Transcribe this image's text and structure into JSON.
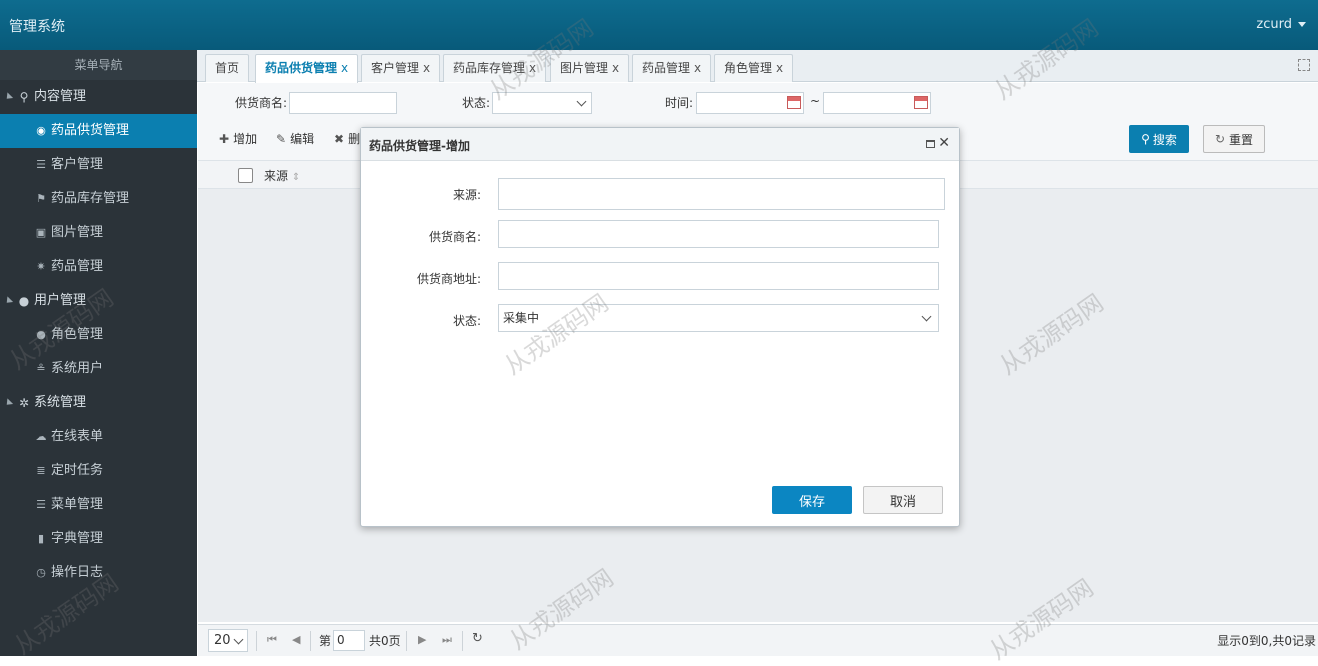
{
  "app": {
    "title": "管理系统",
    "user": "zcurd"
  },
  "sidebar": {
    "header": "菜单导航",
    "groups": [
      {
        "label": "内容管理",
        "items": [
          "药品供货管理",
          "客户管理",
          "药品库存管理",
          "图片管理",
          "药品管理"
        ]
      },
      {
        "label": "用户管理",
        "items": [
          "角色管理",
          "系统用户"
        ]
      },
      {
        "label": "系统管理",
        "items": [
          "在线表单",
          "定时任务",
          "菜单管理",
          "字典管理",
          "操作日志"
        ]
      }
    ]
  },
  "tabs": [
    {
      "label": "首页",
      "close": ""
    },
    {
      "label": "药品供货管理",
      "close": "x"
    },
    {
      "label": "客户管理",
      "close": "x"
    },
    {
      "label": "药品库存管理",
      "close": "x"
    },
    {
      "label": "图片管理",
      "close": "x"
    },
    {
      "label": "药品管理",
      "close": "x"
    },
    {
      "label": "角色管理",
      "close": "x"
    }
  ],
  "filters": {
    "supplier_label": "供货商名:",
    "status_label": "状态:",
    "time_label": "时间:",
    "range_sep": "~",
    "supplier_value": "",
    "status_value": ""
  },
  "toolbar": {
    "add": "增加",
    "edit": "编辑",
    "delete": "删",
    "search": "搜索",
    "reset": "重置"
  },
  "grid": {
    "columns": [
      "来源"
    ]
  },
  "pager": {
    "page_size": "20",
    "page_prefix": "第",
    "page_value": "0",
    "page_suffix": "共0页",
    "summary": "显示0到0,共0记录"
  },
  "dialog": {
    "title": "药品供货管理-增加",
    "fields": [
      {
        "label": "来源:",
        "value": ""
      },
      {
        "label": "供货商名:",
        "value": ""
      },
      {
        "label": "供货商地址:",
        "value": ""
      },
      {
        "label": "状态:",
        "value": "采集中"
      }
    ],
    "save": "保存",
    "cancel": "取消"
  },
  "watermark": "从戎源码网",
  "colors": {
    "topbar": "#0e6c8f",
    "sidebar": "#2b3339",
    "accent": "#0b7fb0"
  }
}
